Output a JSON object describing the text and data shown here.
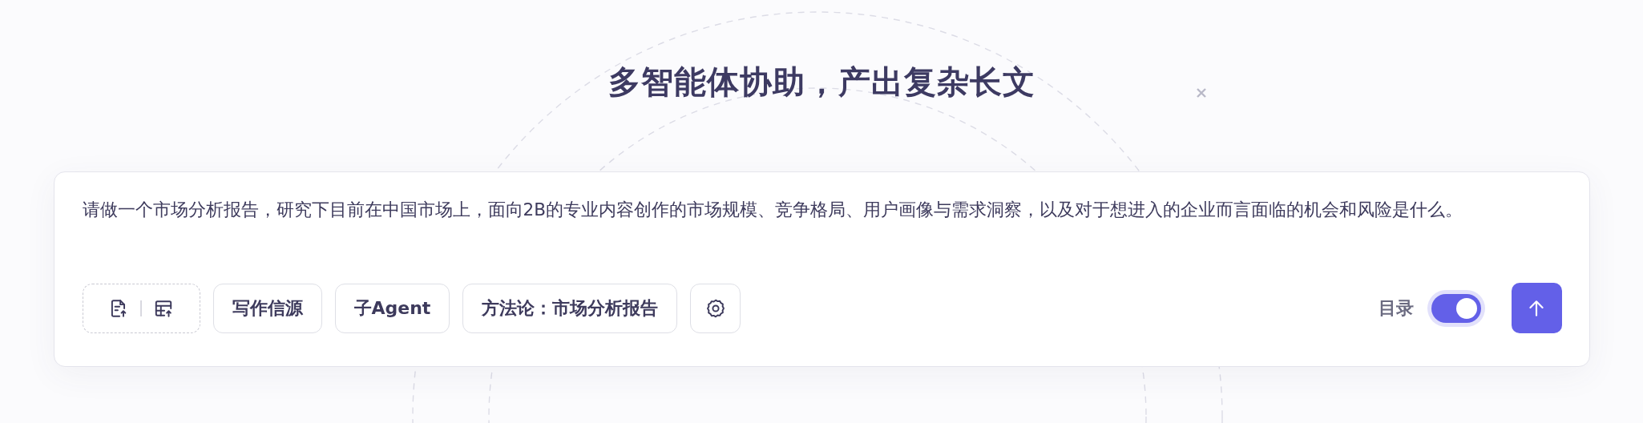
{
  "heading": "多智能体协助，产出复杂长文",
  "prompt": {
    "value": "请做一个市场分析报告，研究下目前在中国市场上，面向2B的专业内容创作的市场规模、竞争格局、用户画像与需求洞察，以及对于想进入的企业而言面临的机会和风险是什么。"
  },
  "toolbar": [
    {
      "kind": "upload"
    },
    {
      "kind": "text",
      "label": "写作信源"
    },
    {
      "kind": "text",
      "label": "子Agent"
    },
    {
      "kind": "text",
      "label": "方法论：市场分析报告"
    },
    {
      "kind": "settings"
    }
  ],
  "outline_toggle": {
    "label": "目录",
    "on": true
  },
  "send": {
    "kind": "arrow-up"
  }
}
